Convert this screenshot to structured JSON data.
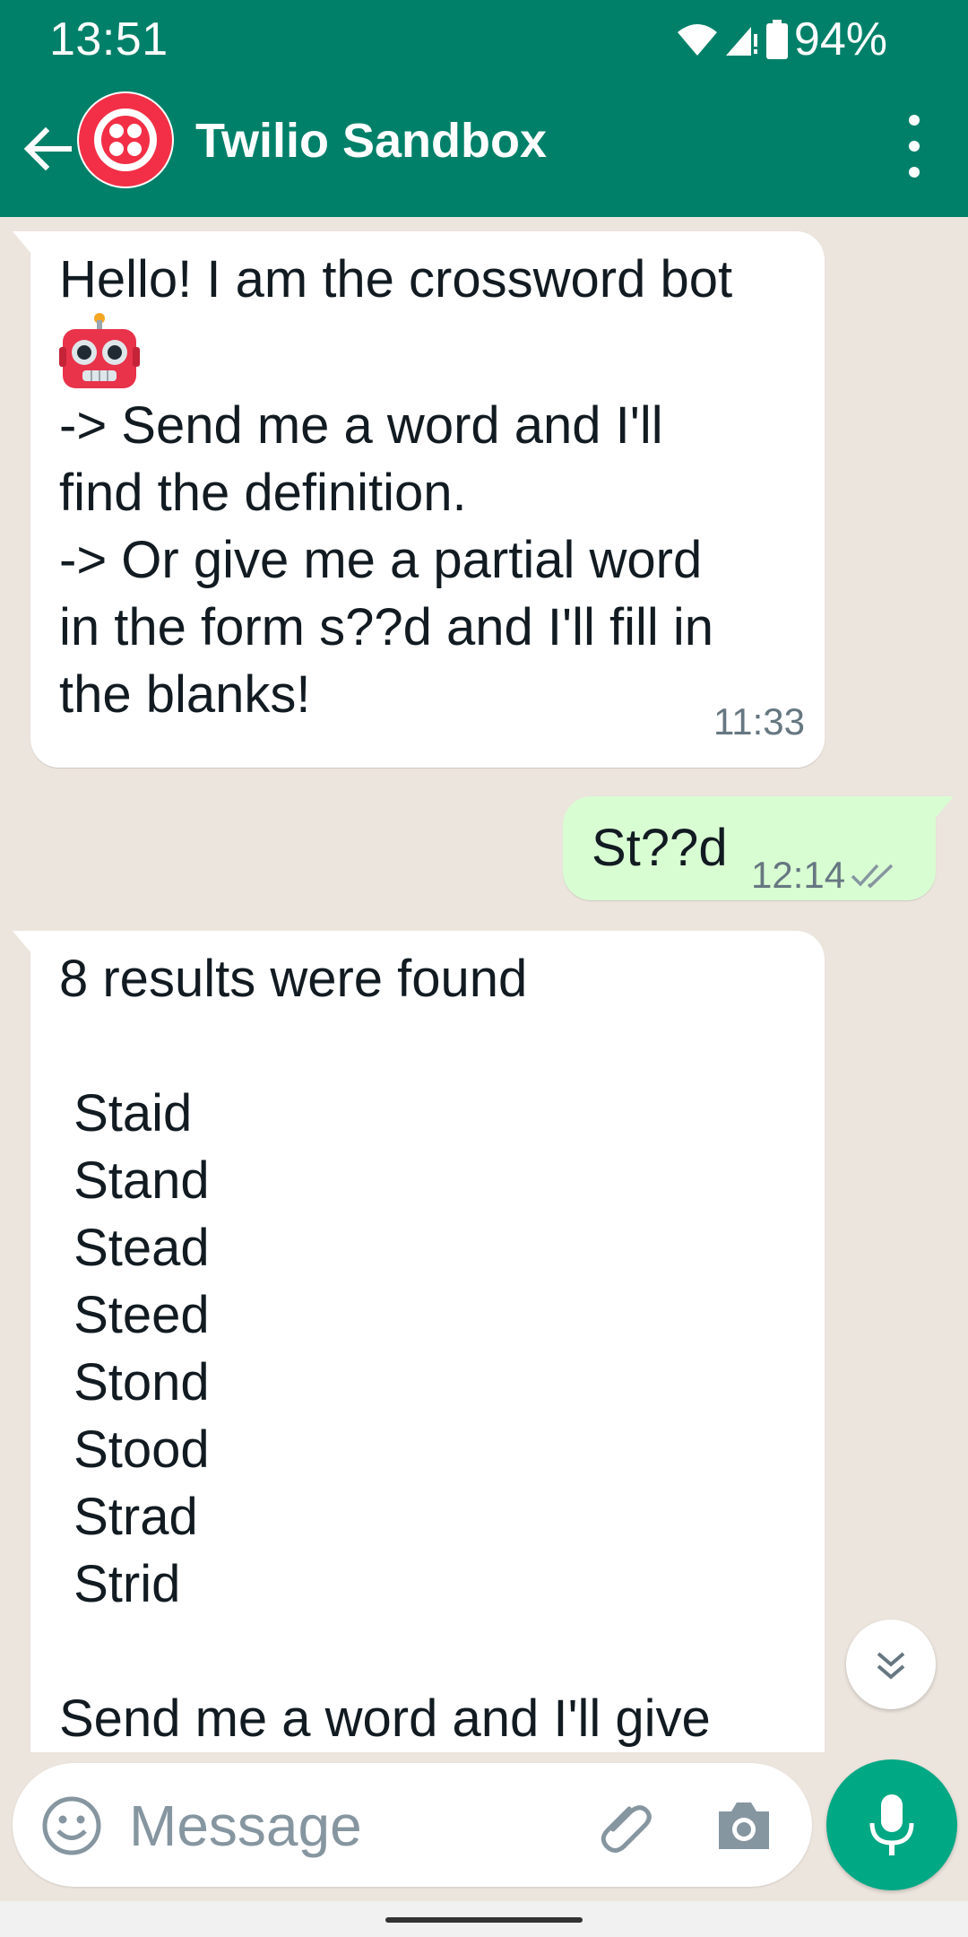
{
  "status_bar": {
    "time": "13:51",
    "battery": "94%"
  },
  "header": {
    "contact_name": "Twilio Sandbox"
  },
  "messages": [
    {
      "direction": "incoming",
      "lines": [
        "Hello! I am the crossword bot",
        "-> Send me a word and I'll",
        "find the definition.",
        "-> Or give me a partial word",
        "in the form s??d and I'll fill in",
        "the blanks!"
      ],
      "emoji": "robot-face",
      "time": "11:33"
    },
    {
      "direction": "outgoing",
      "text": "St??d",
      "time": "12:14",
      "status": "delivered"
    },
    {
      "direction": "incoming",
      "lines": [
        "8 results were found",
        "",
        " Staid",
        " Stand",
        " Stead",
        " Steed",
        " Stond",
        " Stood",
        " Strad",
        " Strid",
        "",
        "Send me a word and I'll give"
      ]
    }
  ],
  "input": {
    "placeholder": "Message"
  },
  "colors": {
    "header": "#008069",
    "chat_background": "#ECE5DD",
    "outgoing_bubble": "#D9FDD3",
    "mic_button": "#00A884"
  }
}
